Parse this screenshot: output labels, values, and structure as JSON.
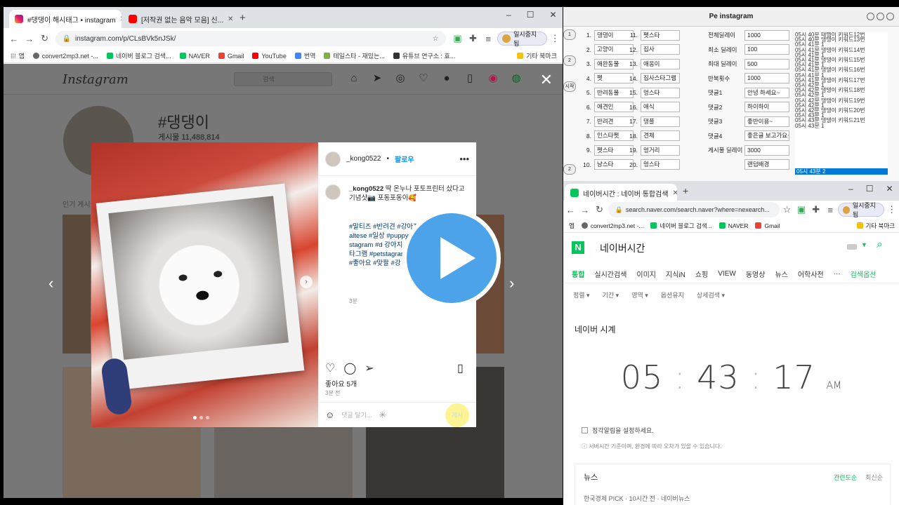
{
  "left_browser": {
    "tabs": [
      {
        "label": "#댕댕이 해시태그 • instagram",
        "close": "✕"
      },
      {
        "label": "[저작권 없는 음악 모음] 신...",
        "close": "✕"
      }
    ],
    "new_tab": "+",
    "url": "instagram.com/p/CLsBVk5nJSk/",
    "profile_label": "일시중지됨",
    "bookmarks": [
      "앱",
      "convert2mp3.net -...",
      "네이버 블로그 검색...",
      "NAVER",
      "Gmail",
      "YouTube",
      "번역",
      "테일스타 - 재밌는...",
      "유튜브 연구소 : 효...",
      "기타 북마크"
    ]
  },
  "instagram": {
    "logo": "Instagram",
    "search_placeholder": "검색",
    "hashtag": "#댕댕이",
    "post_count": "게시물 11,488,814",
    "popular_label": "인기 게시물",
    "close_icon": "✕",
    "prev": "‹",
    "next": "›",
    "post": {
      "username": "_kong0522",
      "follow": "팔로우",
      "more": "•••",
      "caption_user": "_kong0522",
      "caption": "딱 온누나 포토프린터 샀다고 기념샷📷 포동포동이🥰",
      "hashtags": "#말티즈 #반려견 #강아지 #멍스타그램 #maltese #일상 #puppy #댕댕이 #dog #dogstagram #d 강아지 #멍 #반려견 룸 #독스타그램 #petstagram #멍 #데일리 #팔로우 #좋아요 #맞팔 #강 아요 #인스타독 #dog",
      "caption_time": "3분",
      "likes": "좋아요 5개",
      "ago": "3분 전",
      "comment_placeholder": "댓글 달기...",
      "post_button": "게시"
    }
  },
  "pe_window": {
    "title": "Pe instagram",
    "side_buttons": [
      "1",
      "2",
      "시작",
      "2"
    ],
    "keywords_left": [
      {
        "n": "1.",
        "v": "댕댕이"
      },
      {
        "n": "2.",
        "v": "고양이"
      },
      {
        "n": "3.",
        "v": "애완동물"
      },
      {
        "n": "4.",
        "v": "펫"
      },
      {
        "n": "5.",
        "v": "반려동물"
      },
      {
        "n": "6.",
        "v": "애견인"
      },
      {
        "n": "7.",
        "v": "반려견"
      },
      {
        "n": "8.",
        "v": "인스타펫"
      },
      {
        "n": "9.",
        "v": "펫스타"
      },
      {
        "n": "10.",
        "v": "냥스타"
      }
    ],
    "keywords_right": [
      {
        "n": "11.",
        "v": "펫스타"
      },
      {
        "n": "12.",
        "v": "집사"
      },
      {
        "n": "13.",
        "v": "애옹이"
      },
      {
        "n": "14.",
        "v": "집사스타그램"
      },
      {
        "n": "15.",
        "v": "멍스타"
      },
      {
        "n": "16.",
        "v": "애식"
      },
      {
        "n": "17.",
        "v": "댕플"
      },
      {
        "n": "18.",
        "v": "견체"
      },
      {
        "n": "19.",
        "v": "멍거리"
      },
      {
        "n": "20.",
        "v": "멍스타"
      }
    ],
    "settings": [
      {
        "label": "전체딜레이",
        "value": "1000"
      },
      {
        "label": "최소 딜레이",
        "value": "100"
      },
      {
        "label": "최대 딜레이",
        "value": "500"
      },
      {
        "label": "반복횟수",
        "value": "1000"
      },
      {
        "label": "댓글1",
        "value": "안녕 하세요~"
      },
      {
        "label": "댓글2",
        "value": "하이하이"
      },
      {
        "label": "댓글3",
        "value": "좋반이용~"
      },
      {
        "label": "댓글4",
        "value": "좋은글 보고가요~"
      },
      {
        "label": "게시물 딜레이",
        "value": "3000"
      },
      {
        "label": "",
        "value": "랜덤배경"
      }
    ],
    "log": [
      "05시 40분 태명이 키워드12번",
      "05시 40분 댕댕이 키워드13번",
      "05시 41분 1",
      "05시 41분 댕댕이 키워드14번",
      "05시 41분 1",
      "05시 41분 댕댕이 키워드15번",
      "05시 41분 1",
      "05시 41분 댕댕이 키워드16번",
      "05시 41분 1",
      "05시 41분 댕댕이 키워드17번",
      "05시 42분 1",
      "05시 42분 댕댕이 키워드18번",
      "05시 42분 1",
      "05시 42분 댕댕이 키워드19번",
      "05시 42분 1",
      "05시 42분 댕댕이 키워드20번",
      "05시 43분 1",
      "05시 43분 댕댕이 키워드21번",
      "05시 43분 1"
    ],
    "log_selected": "05시 43분 2"
  },
  "naver_browser": {
    "tab_label": "네이버시간 : 네이버 통합검색",
    "new_tab": "+",
    "url": "search.naver.com/search.naver?where=nexearch...",
    "profile_label": "일시중지됨",
    "bookmarks": [
      "앱",
      "convert2mp3.net -...",
      "네이버 블로그 검색...",
      "NAVER",
      "Gmail",
      "기타 북마크"
    ],
    "logo": "N",
    "query": "네이버시간",
    "nav": [
      "통합",
      "실시간검색",
      "이미지",
      "지식iN",
      "쇼핑",
      "VIEW",
      "동영상",
      "뉴스",
      "어학사전",
      "···",
      "검색옵션"
    ],
    "options": [
      "정렬 ▾",
      "기간 ▾",
      "영역 ▾",
      "옵션유지",
      "상세검색 ▾"
    ],
    "clock_title": "네이버 시계",
    "clock": {
      "h": "05",
      "m": "43",
      "s": "17",
      "ampm": "AM",
      "sep": ":"
    },
    "alarm_check": "정각알림을 설정하세요.",
    "note": "ⓘ 서버시간 기준이며, 환경에 따라 오차가 있을 수 있습니다.",
    "news_title": "뉴스",
    "news_sort": [
      "관련도순",
      "최신순"
    ],
    "news_item": "한국경제 PICK · 10시간 전 · 네이버뉴스"
  }
}
